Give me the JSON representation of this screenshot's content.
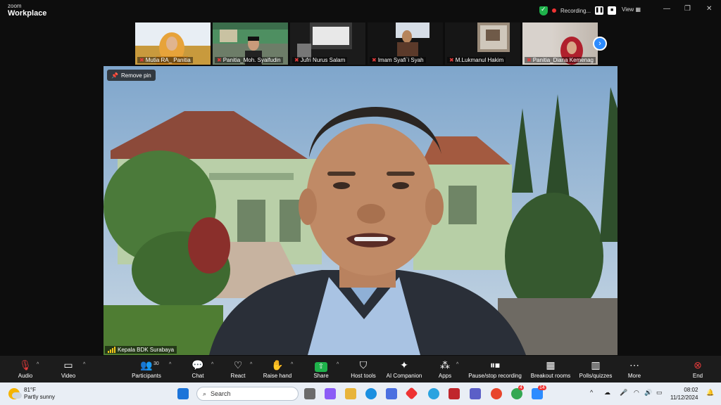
{
  "window": {
    "brand_top": "zoom",
    "brand_bottom": "Workplace",
    "recording_label": "Recording...",
    "view_label": "View",
    "minimize_glyph": "—",
    "maximize_glyph": "❐",
    "close_glyph": "✕"
  },
  "gallery": {
    "participants": [
      {
        "name": "Mutia RA_ Panitia",
        "muted": true
      },
      {
        "name": "Panitia_Moh. Syaifudin",
        "muted": true
      },
      {
        "name": "Jufri Nurus Salam",
        "muted": true
      },
      {
        "name": "Imam Syafi`i Syah",
        "muted": true
      },
      {
        "name": "M.Lukmanul Hakim",
        "muted": true
      },
      {
        "name": "Panitia_Diana Kemenag",
        "muted": true
      }
    ],
    "next_glyph": "›"
  },
  "main_video": {
    "pin_label": "Remove pin",
    "speaker_name": "Kepala BDK Surabaya"
  },
  "toolbar": {
    "audio": "Audio",
    "video": "Video",
    "participants": "Participants",
    "participants_count": "30",
    "chat": "Chat",
    "react": "React",
    "raise_hand": "Raise hand",
    "share": "Share",
    "host_tools": "Host tools",
    "ai_companion": "AI Companion",
    "apps": "Apps",
    "pause_recording": "Pause/stop recording",
    "breakout_rooms": "Breakout rooms",
    "polls": "Polls/quizzes",
    "more": "More",
    "end": "End"
  },
  "taskbar": {
    "temperature": "81°F",
    "weather": "Partly sunny",
    "search_placeholder": "Search",
    "time": "08:02",
    "date": "11/12/2024",
    "badge_a": "4",
    "badge_b": "14"
  },
  "colors": {
    "accent": "#2d8cff",
    "share_green": "#1fb24b",
    "end_red": "#e53b3b",
    "toolbar_bg": "#1c1c1c"
  }
}
